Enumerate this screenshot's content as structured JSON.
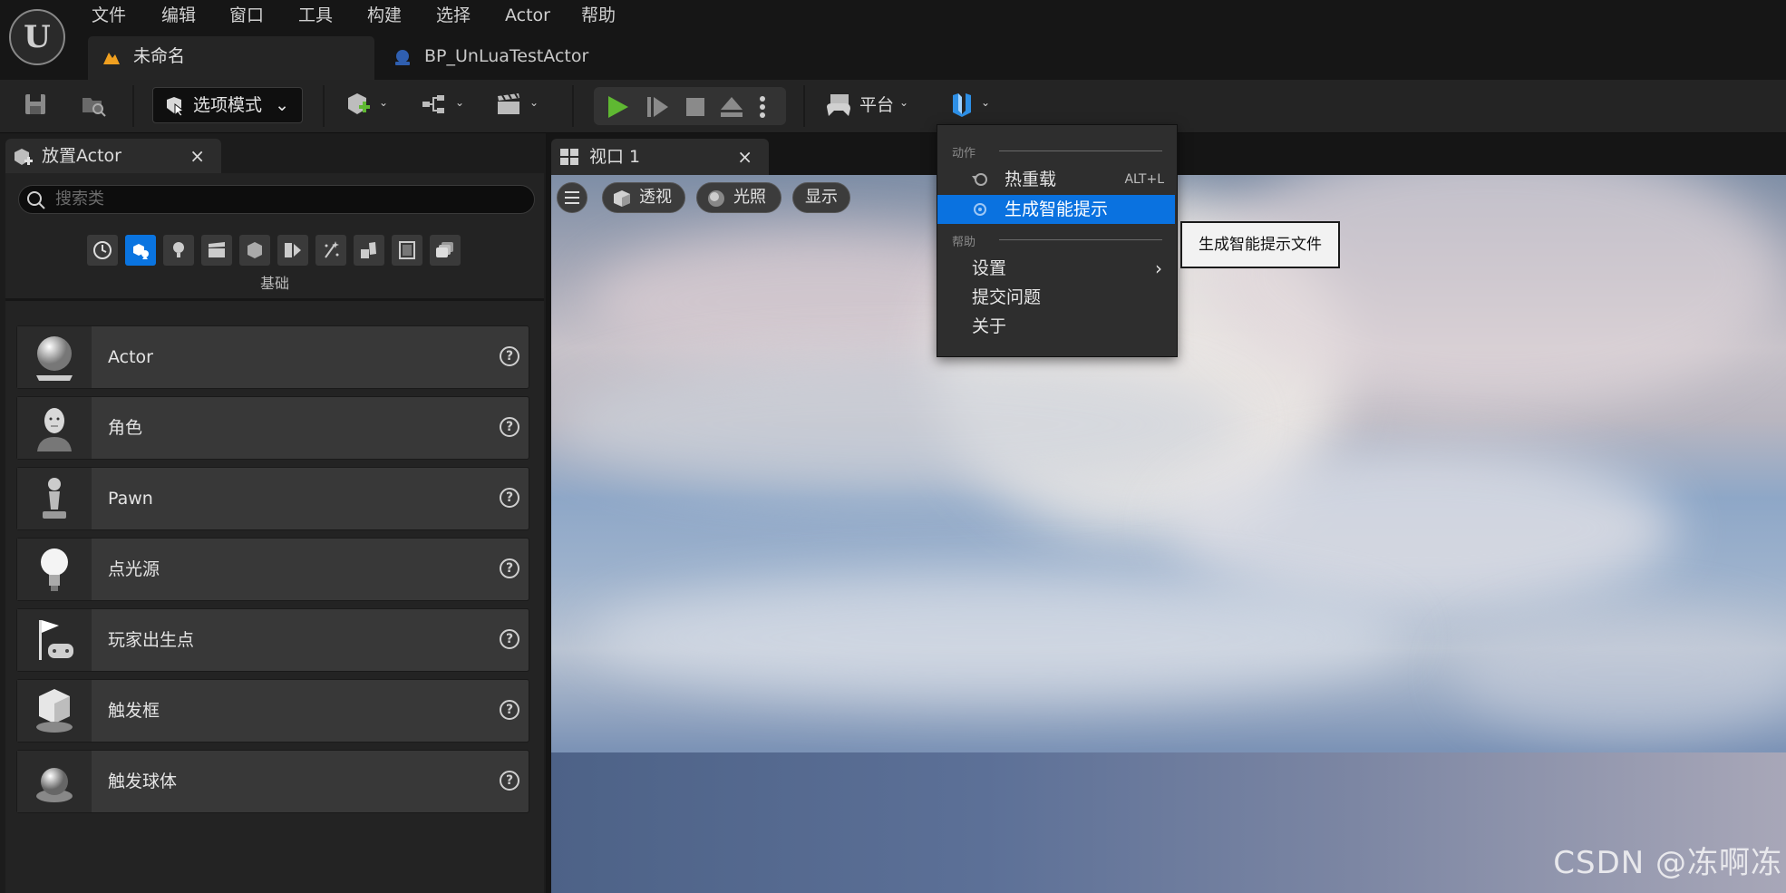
{
  "menubar": {
    "items": [
      "文件",
      "编辑",
      "窗口",
      "工具",
      "构建",
      "选择",
      "Actor",
      "帮助"
    ]
  },
  "doc_tabs": {
    "active": "未命名",
    "second": "BP_UnLuaTestActor"
  },
  "toolbar": {
    "mode_label": "选项模式",
    "platform_label": "平台"
  },
  "place_panel": {
    "tab_title": "放置Actor",
    "close": "×",
    "search_placeholder": "搜索类",
    "category_label": "基础",
    "items": [
      {
        "name": "Actor",
        "icon": "sphere-icon"
      },
      {
        "name": "角色",
        "icon": "character-icon"
      },
      {
        "name": "Pawn",
        "icon": "pawn-icon"
      },
      {
        "name": "点光源",
        "icon": "lightbulb-icon"
      },
      {
        "name": "玩家出生点",
        "icon": "player-start-icon"
      },
      {
        "name": "触发框",
        "icon": "trigger-box-icon"
      },
      {
        "name": "触发球体",
        "icon": "trigger-sphere-icon"
      }
    ],
    "help_glyph": "?"
  },
  "viewport": {
    "tab_title": "视口 1",
    "close": "×",
    "perspective_label": "透视",
    "lighting_label": "光照",
    "show_label": "显示",
    "watermark": "CSDN @冻啊冻"
  },
  "dropdown": {
    "section_actions": "动作",
    "hot_reload": "热重载",
    "hot_reload_shortcut": "ALT+L",
    "generate_hints": "生成智能提示",
    "section_help": "帮助",
    "settings": "设置",
    "submit_issue": "提交问题",
    "about": "关于",
    "tooltip": "生成智能提示文件"
  },
  "colors": {
    "accent": "#0a72e0",
    "play_green": "#5fb832",
    "tab_orange": "#f0a020"
  }
}
